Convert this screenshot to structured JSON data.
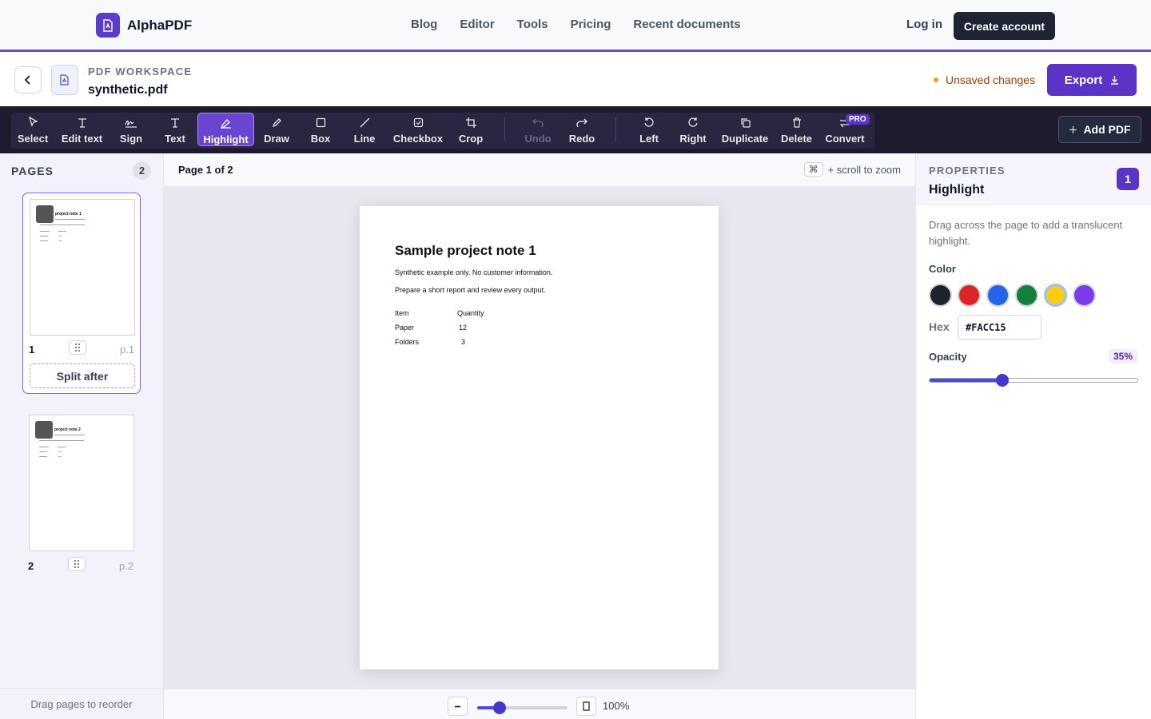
{
  "brand": {
    "name": "AlphaPDF"
  },
  "nav": {
    "links": [
      "Blog",
      "Editor",
      "Tools",
      "Pricing",
      "Recent documents"
    ],
    "login": "Log in",
    "create_account": "Create account"
  },
  "workspace": {
    "label": "PDF WORKSPACE",
    "filename": "synthetic.pdf",
    "status": "Unsaved changes",
    "export": "Export"
  },
  "toolbar": {
    "tools": [
      "Select",
      "Edit text",
      "Sign",
      "Text",
      "Highlight",
      "Draw",
      "Box",
      "Line",
      "Checkbox",
      "Crop"
    ],
    "history": [
      "Undo",
      "Redo"
    ],
    "page_tools": [
      "Left",
      "Right",
      "Duplicate",
      "Delete",
      "Convert"
    ],
    "active_tool": "Highlight",
    "pro_badge": "PRO",
    "add_pdf": "Add PDF"
  },
  "pages": {
    "title": "PAGES",
    "count": "2",
    "items": [
      {
        "number": "1",
        "label": "p.1",
        "mini_title": "project note 1"
      },
      {
        "number": "2",
        "label": "p.2",
        "mini_title": "project note 2"
      }
    ],
    "split_after": "Split after",
    "footer": "Drag pages to reorder"
  },
  "canvas": {
    "page_indicator": "Page 1 of 2",
    "zoom_key": "⌘",
    "zoom_hint": "+ scroll to zoom",
    "zoom_value": "100%",
    "zoom_level": 0.25
  },
  "document": {
    "title": "Sample project note 1",
    "lines": [
      "Synthetic example only. No customer information.",
      "Prepare a short report and review every output."
    ],
    "table": {
      "headers": [
        "Item",
        "Quantity"
      ],
      "rows": [
        [
          "Paper",
          "12"
        ],
        [
          "Folders",
          "3"
        ]
      ]
    }
  },
  "properties": {
    "label": "PROPERTIES",
    "title": "Highlight",
    "badge": "1",
    "description": "Drag across the page to add a translucent highlight.",
    "color_label": "Color",
    "colors": [
      "#1f2330",
      "#dc2626",
      "#2563eb",
      "#15803d",
      "#facc15",
      "#7c3aed"
    ],
    "selected_color": "#facc15",
    "hex_label": "Hex",
    "hex_value": "#FACC15",
    "opacity_label": "Opacity",
    "opacity_value": "35%",
    "opacity": 0.35
  }
}
